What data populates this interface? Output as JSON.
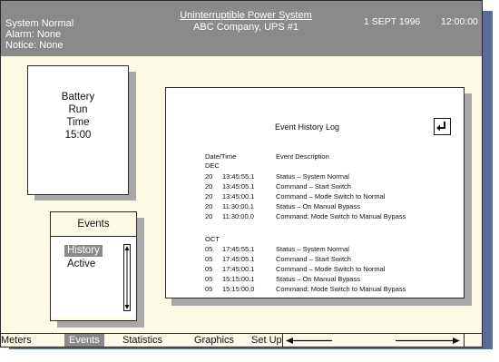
{
  "header": {
    "status": "System Normal",
    "alarm": "Alarm:  None",
    "notice": "Notice: None",
    "title": "Uninterruptible Power System",
    "subtitle": "ABC Company, UPS #1",
    "date": "1 SEPT 1996",
    "time": "12:00:00"
  },
  "battery": {
    "lines": [
      "Battery",
      "Run",
      "Time",
      "15:00"
    ]
  },
  "event_log": {
    "title": "Event History Log",
    "return_icon": "return-arrow-icon",
    "col_datetime": "Date/Time",
    "col_description": "Event Description",
    "groups": [
      {
        "month": "DEC",
        "rows": [
          {
            "day": "20",
            "time": "13:45:55.1",
            "desc": "Status – System Normal"
          },
          {
            "day": "20",
            "time": "13:45:05.1",
            "desc": "Command – Start Switch"
          },
          {
            "day": "20",
            "time": "13:45:00.1",
            "desc": "Command – Mode Switch to Normal"
          },
          {
            "day": "20",
            "time": "11:30:00.1",
            "desc": "Status – On Manual Bypass"
          },
          {
            "day": "20",
            "time": "11:30:00.0",
            "desc": "Command:  Mode Switch to Manual Bypass"
          }
        ]
      },
      {
        "month": "OCT",
        "rows": [
          {
            "day": "05",
            "time": "17:45:55.1",
            "desc": "Status – System Normal"
          },
          {
            "day": "05",
            "time": "17:45:05.1",
            "desc": "Command – Start Switch"
          },
          {
            "day": "05",
            "time": "17:45:00.1",
            "desc": "Command – Mode Switch to Normal"
          },
          {
            "day": "05",
            "time": "15:15:00.1",
            "desc": "Status – On Manual Bypass"
          },
          {
            "day": "05",
            "time": "15:15:00.0",
            "desc": "Command:  Mode Switch to Manual Bypass"
          }
        ]
      }
    ]
  },
  "events_panel": {
    "title": "Events",
    "items": [
      {
        "label": "History",
        "selected": true
      },
      {
        "label": "Active",
        "selected": false
      }
    ]
  },
  "menubar": {
    "items": [
      {
        "label": "Meters",
        "selected": false
      },
      {
        "label": "Events",
        "selected": true
      },
      {
        "label": "Statistics",
        "selected": false
      },
      {
        "label": "Graphics",
        "selected": false
      },
      {
        "label": "Set Up",
        "selected": false
      }
    ],
    "left_arrow_icon": "left-arrow-icon",
    "right_arrow_icon": "right-arrow-icon"
  },
  "colors": {
    "background": "#fdfbe8",
    "header": "#8a8a8a",
    "shadow": "#5a6b95",
    "panel_shadow": "#a8a8a8"
  }
}
